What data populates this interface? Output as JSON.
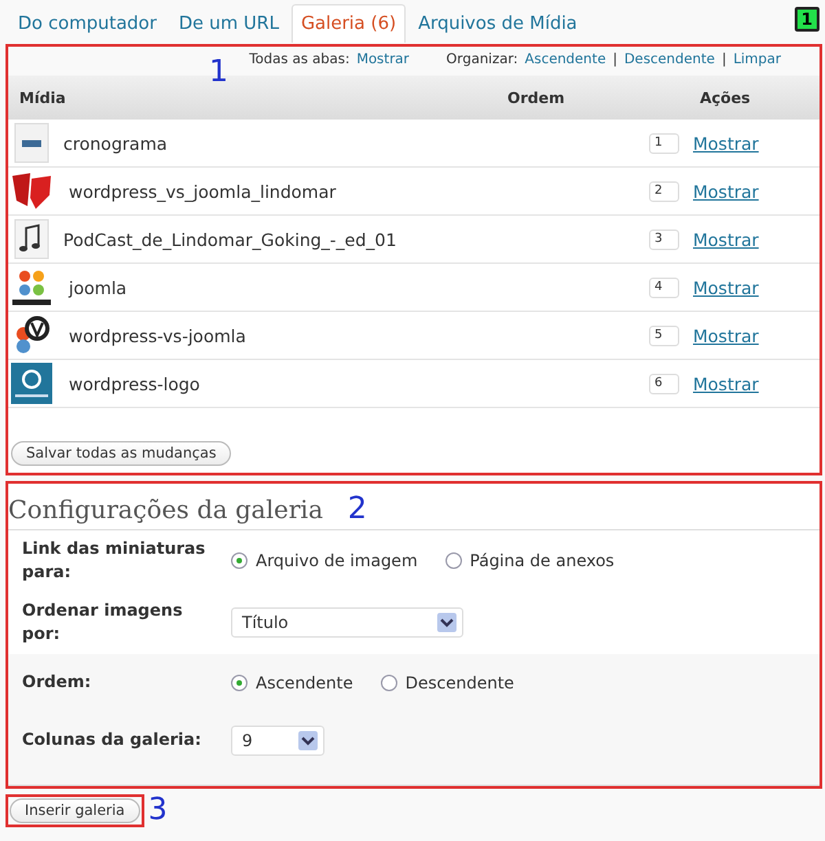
{
  "tabs": [
    {
      "label": "Do computador",
      "selected": false
    },
    {
      "label": "De um URL",
      "selected": false
    },
    {
      "label": "Galeria (6)",
      "selected": true
    },
    {
      "label": "Arquivos de Mídia",
      "selected": false
    }
  ],
  "corner_badge": "1",
  "gallery_section": {
    "annotation": "1",
    "all_tabs": {
      "label": "Todas as abas:",
      "link": "Mostrar"
    },
    "sort": {
      "label": "Organizar:",
      "separator": "|",
      "links": [
        "Ascendente",
        "Descendente",
        "Limpar"
      ]
    },
    "table": {
      "columns": [
        "Mídia",
        "Ordem",
        "Ações"
      ],
      "rows": [
        {
          "kind": "document",
          "name": "cronograma",
          "order": "1",
          "action": "Mostrar"
        },
        {
          "kind": "versus",
          "name": "wordpress_vs_joomla_lindomar",
          "order": "2",
          "action": "Mostrar"
        },
        {
          "kind": "audio",
          "name": "PodCast_de_Lindomar_Goking_-_ed_01",
          "order": "3",
          "action": "Mostrar"
        },
        {
          "kind": "joomla",
          "name": "joomla",
          "order": "4",
          "action": "Mostrar"
        },
        {
          "kind": "mixed",
          "name": "wordpress-vs-joomla",
          "order": "5",
          "action": "Mostrar"
        },
        {
          "kind": "wordpress",
          "name": "wordpress-logo",
          "order": "6",
          "action": "Mostrar"
        }
      ]
    },
    "save_button": "Salvar todas as mudanças"
  },
  "settings_section": {
    "annotation": "2",
    "title": "Configurações da galeria",
    "fields": [
      {
        "kind": "radio",
        "label": "Link das miniaturas para:",
        "options": [
          {
            "label": "Arquivo de imagem",
            "selected": true
          },
          {
            "label": "Página de anexos",
            "selected": false
          }
        ]
      },
      {
        "kind": "select",
        "label": "Ordenar imagens por:",
        "value": "Título",
        "wide": true
      },
      {
        "kind": "radio",
        "label": "Ordem:",
        "options": [
          {
            "label": "Ascendente",
            "selected": true
          },
          {
            "label": "Descendente",
            "selected": false
          }
        ]
      },
      {
        "kind": "select",
        "label": "Colunas da galeria:",
        "value": "9",
        "wide": false
      }
    ]
  },
  "insert_button": {
    "label": "Inserir galeria",
    "annotation": "3"
  }
}
